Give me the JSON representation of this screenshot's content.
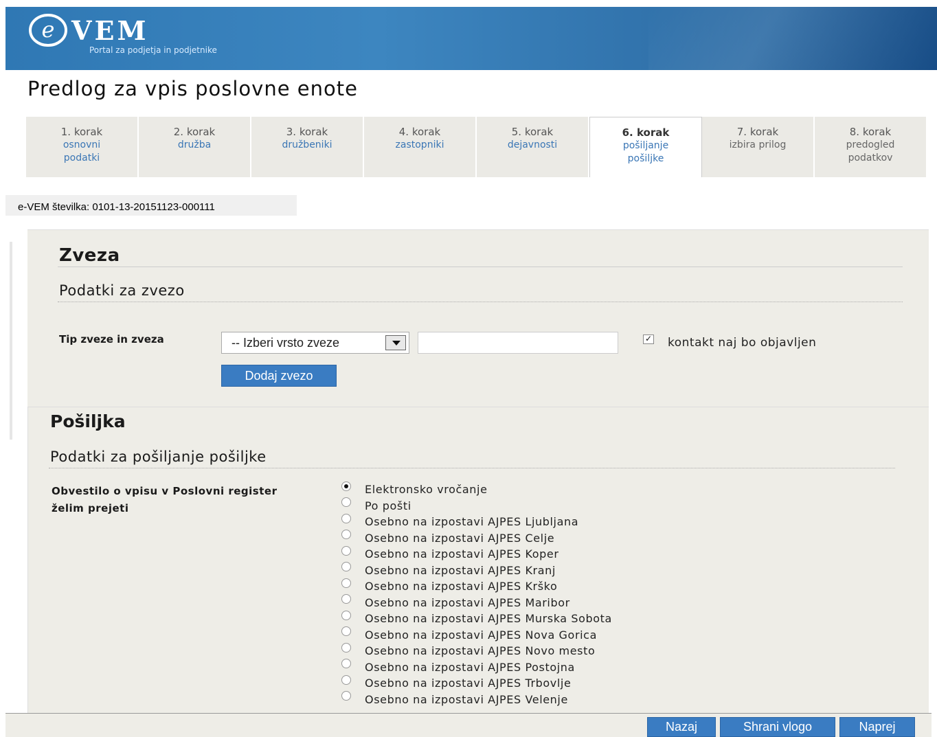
{
  "header": {
    "logo_text": "VEM",
    "logo_subtitle": "Portal za podjetja in podjetnike"
  },
  "page_title": "Predlog za vpis poslovne enote",
  "steps": [
    {
      "step": "1. korak",
      "label": "osnovni podatki"
    },
    {
      "step": "2. korak",
      "label": "družba"
    },
    {
      "step": "3. korak",
      "label": "družbeniki"
    },
    {
      "step": "4. korak",
      "label": "zastopniki"
    },
    {
      "step": "5. korak",
      "label": "dejavnosti"
    },
    {
      "step": "6. korak",
      "label": "pošiljanje pošiljke"
    },
    {
      "step": "7. korak",
      "label": "izbira prilog"
    },
    {
      "step": "8. korak",
      "label": "predogled podatkov"
    }
  ],
  "evem_number": "e-VEM  številka: 0101-13-20151123-000111",
  "zveza": {
    "title": "Zveza",
    "subtitle": "Podatki za zvezo",
    "type_label": "Tip zveze in zveza",
    "select_value": "-- Izberi vrsto zveze",
    "input_value": "",
    "publish_checkbox_label": "kontakt naj bo objavljen",
    "publish_checked": true,
    "add_button": "Dodaj zvezo"
  },
  "posiljka": {
    "title": "Pošiljka",
    "subtitle": "Podatki za pošiljanje pošiljke",
    "notice_label": "Obvestilo o vpisu v Poslovni register želim prejeti",
    "selected_option": "Elektronsko vročanje",
    "options": [
      "Elektronsko vročanje",
      "Po pošti",
      "Osebno na izpostavi AJPES Ljubljana",
      "Osebno na izpostavi AJPES Celje",
      "Osebno na izpostavi AJPES Koper",
      "Osebno na izpostavi AJPES Kranj",
      "Osebno na izpostavi AJPES Krško",
      "Osebno na izpostavi AJPES Maribor",
      "Osebno na izpostavi AJPES Murska Sobota",
      "Osebno na izpostavi AJPES Nova Gorica",
      "Osebno na izpostavi AJPES Novo mesto",
      "Osebno na izpostavi AJPES Postojna",
      "Osebno na izpostavi AJPES Trbovlje",
      "Osebno na izpostavi AJPES Velenje"
    ]
  },
  "footer": {
    "back_button": "Nazaj",
    "save_button": "Shrani vlogo",
    "next_button": "Naprej"
  }
}
